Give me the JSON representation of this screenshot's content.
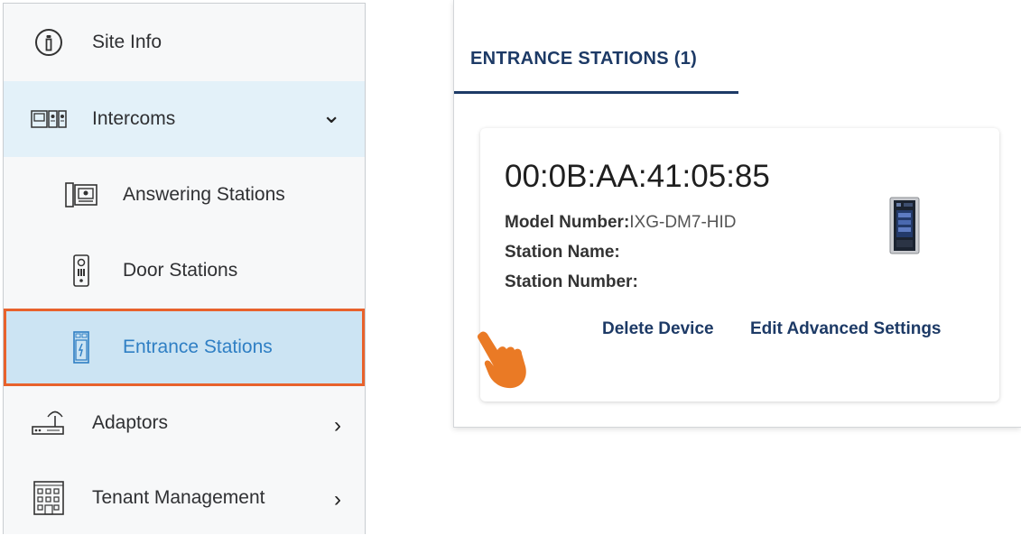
{
  "sidebar": {
    "items": [
      {
        "label": "Site Info",
        "icon": "info-icon"
      },
      {
        "label": "Intercoms",
        "icon": "intercom-icon",
        "chevron": "⌄"
      },
      {
        "label": "Answering Stations",
        "icon": "answering-station-icon"
      },
      {
        "label": "Door Stations",
        "icon": "door-station-icon"
      },
      {
        "label": "Entrance Stations",
        "icon": "entrance-station-icon",
        "active": true
      },
      {
        "label": "Adaptors",
        "icon": "adaptor-icon",
        "chevron": "›"
      },
      {
        "label": "Tenant Management",
        "icon": "building-icon",
        "chevron": "›"
      }
    ]
  },
  "tab": {
    "label": "ENTRANCE STATIONS (1)"
  },
  "card": {
    "mac": "00:0B:AA:41:05:85",
    "model_label": "Model Number:",
    "model_value": "IXG-DM7-HID",
    "station_name_label": "Station Name:",
    "station_number_label": "Station Number:",
    "delete_label": "Delete Device",
    "edit_label": "Edit Advanced Settings"
  },
  "colors": {
    "accent": "#1d3a66",
    "highlight_border": "#e8622c",
    "active_bg": "#cce4f3",
    "active_text": "#2f7fc4"
  }
}
